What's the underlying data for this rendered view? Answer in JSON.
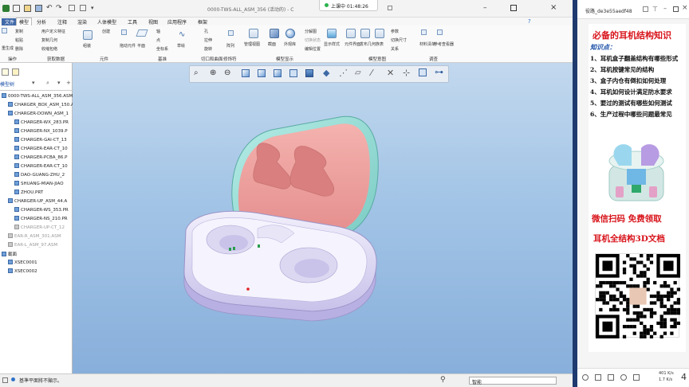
{
  "title_bar": {
    "title": "0000-TWS-ALL_ASM_356 (活动的) - C",
    "recording": "上课中 01:48:26"
  },
  "ribbon_tabs": [
    "模型",
    "分析",
    "注释",
    "渲染",
    "人体模型",
    "工具",
    "视图",
    "应用程序",
    "框架"
  ],
  "ribbon_groups": [
    "操作",
    "获取数据",
    "元件",
    "基准",
    "切口和曲面",
    "修饰符",
    "模型显示",
    "模型意图",
    "调查"
  ],
  "ribbon_items": {
    "ops": [
      "复制",
      "粘贴",
      "删除",
      "重生成"
    ],
    "data": [
      "用户定义特征",
      "复制几何",
      "收缩包络"
    ],
    "component": [
      "创建",
      "组装",
      "拖动元件",
      "平面"
    ],
    "datum": [
      "轴",
      "点",
      "坐标系",
      "草绘"
    ],
    "cut": [
      "孔",
      "拉伸",
      "旋转"
    ],
    "modifier": [
      "阵列"
    ],
    "display": [
      "管理视图",
      "截面",
      "外观库",
      "分解图",
      "切换状态",
      "编辑位置",
      "显示样式"
    ],
    "intent": [
      "元件界面",
      "发布几何",
      "族表",
      "参数",
      "切换尺寸",
      "关系"
    ],
    "investigate": [
      "材料清单",
      "参考查看器"
    ]
  },
  "left_pane": {
    "tab_label": "模型树",
    "tree": [
      {
        "label": "0000-TWS-ALL_ASM_356.ASM",
        "indent": 0,
        "grey": false,
        "icon": "assembly-icon"
      },
      {
        "label": "CHARGER_BOX_ASM_150.AS",
        "indent": 1,
        "grey": false,
        "icon": "assembly-icon"
      },
      {
        "label": "CHARGER-DOWN_ASM_1",
        "indent": 1,
        "grey": false,
        "icon": "assembly-icon"
      },
      {
        "label": "CHARGER-WX_283.PR",
        "indent": 2,
        "grey": false,
        "icon": "part-icon"
      },
      {
        "label": "CHARGER-NX_1039.P",
        "indent": 2,
        "grey": false,
        "icon": "part-icon"
      },
      {
        "label": "CHARGER-GAI-CT_13",
        "indent": 2,
        "grey": false,
        "icon": "part-icon"
      },
      {
        "label": "CHARGER-EAR-CT_10",
        "indent": 2,
        "grey": false,
        "icon": "part-icon"
      },
      {
        "label": "CHARGER-PCBA_86.P",
        "indent": 2,
        "grey": false,
        "icon": "part-icon"
      },
      {
        "label": "CHARGER-EAR-CT_10",
        "indent": 2,
        "grey": false,
        "icon": "part-icon"
      },
      {
        "label": "DAO-GUANG-ZHU_2",
        "indent": 2,
        "grey": false,
        "icon": "part-icon"
      },
      {
        "label": "SHUANG-MIAN-JIAO",
        "indent": 2,
        "grey": false,
        "icon": "part-icon"
      },
      {
        "label": "ZHOU.PRT",
        "indent": 2,
        "grey": false,
        "icon": "part-icon"
      },
      {
        "label": "CHARGER-UP_ASM_44.A",
        "indent": 1,
        "grey": false,
        "icon": "assembly-icon"
      },
      {
        "label": "CHARGER-WS_353.PR",
        "indent": 2,
        "grey": false,
        "icon": "part-icon"
      },
      {
        "label": "CHARGER-NS_210.PR",
        "indent": 2,
        "grey": false,
        "icon": "part-icon"
      },
      {
        "label": "CHARGER-UP-CT_12",
        "indent": 2,
        "grey": true,
        "icon": "part-icon"
      },
      {
        "label": "EAR-R_ASM_301.ASM",
        "indent": 1,
        "grey": true,
        "icon": "assembly-icon"
      },
      {
        "label": "EAR-L_ASM_97.ASM",
        "indent": 1,
        "grey": true,
        "icon": "assembly-icon"
      },
      {
        "label": "截面",
        "indent": 0,
        "grey": false,
        "icon": "section-folder-icon"
      },
      {
        "label": "XSEC0001",
        "indent": 1,
        "grey": false,
        "icon": "section-icon"
      },
      {
        "label": "XSEC0002",
        "indent": 1,
        "grey": false,
        "icon": "section-icon"
      }
    ]
  },
  "status_bar": {
    "message": "基準平面將不顯示。",
    "filter": "智能"
  },
  "right_pane": {
    "id_label": "役路_de3e55aedf48",
    "headline": "必备的耳机结构知识",
    "subhead": "知识点：",
    "points": [
      "1、耳机盒子翻盖结构有哪些形式",
      "2、耳机按键常见的结构",
      "3、盒子内仓有倒扣如何处理",
      "4、耳机如何设计满足防水要求",
      "5、要过的测试有哪些如何测试",
      "6、生产过程中哪些问题最常见"
    ],
    "cta1": "微信扫码  免费领取",
    "cta2": "耳机全结构3D文档",
    "net_up": "401 K/s",
    "net_down": "1.7 K/s",
    "badge": "4"
  },
  "colors": {
    "headline": "#d8141b",
    "subhead": "#1a4fa8",
    "viewport_top": "#c2d8ee",
    "viewport_bottom": "#88afdb",
    "case_body": "#e3e0f6",
    "lid_inner": "#ea9a9a",
    "lid_rim": "#98ddd6"
  }
}
